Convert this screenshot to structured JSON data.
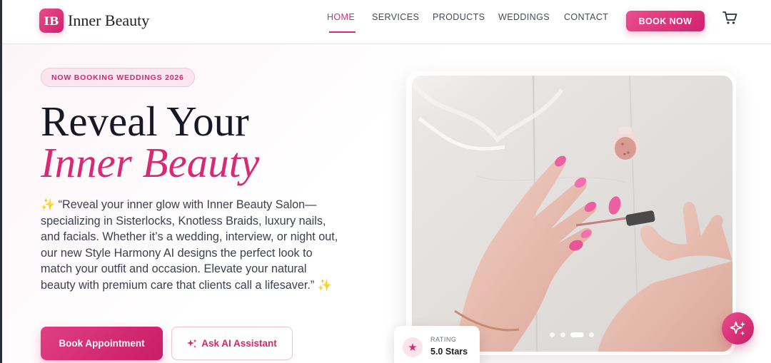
{
  "brand": {
    "badge": "IB",
    "name": "Inner Beauty"
  },
  "nav": {
    "items": [
      {
        "label": "HOME",
        "active": true
      },
      {
        "label": "SERVICES"
      },
      {
        "label": "PRODUCTS"
      },
      {
        "label": "WEDDINGS"
      },
      {
        "label": "CONTACT"
      }
    ],
    "cta": "BOOK NOW",
    "cart_icon": "cart-icon"
  },
  "hero": {
    "pill": "NOW BOOKING WEDDINGS 2026",
    "title_line1": "Reveal Your",
    "title_line2": "Inner Beauty",
    "description_open": "✨",
    "description": " “Reveal your inner glow with Inner Beauty Salon—specializing in Sisterlocks, Knotless Braids, luxury nails, and facials. Whether it’s a wedding, interview, or night out, our new Style Harmony AI designs the perfect look to match your outfit and occasion. Elevate your natural beauty with premium care that clients call a lifesaver.” ",
    "description_close": "✨",
    "primary_button": "Book Appointment",
    "secondary_button": "Ask AI Assistant",
    "secondary_icon": "sparkles-icon"
  },
  "carousel": {
    "slide_count": 4,
    "active_index": 2
  },
  "rating": {
    "label": "RATING",
    "value": "5.0 Stars",
    "icon": "star-icon"
  },
  "colors": {
    "accent": "#d82a74",
    "text_dark": "#161826",
    "pill_bg": "#fbe5ee"
  }
}
